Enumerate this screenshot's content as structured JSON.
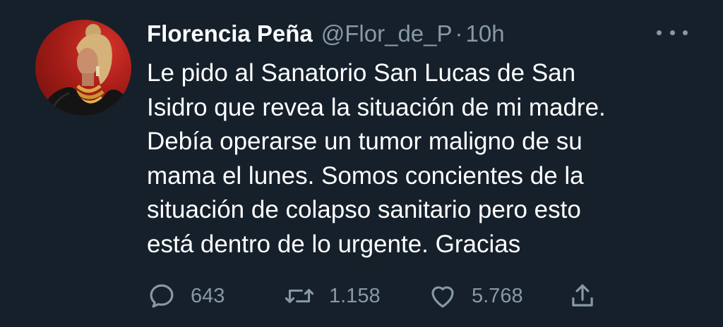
{
  "tweet": {
    "author": {
      "display_name": "Florencia Peña",
      "handle": "@Flor_de_P"
    },
    "separator": "·",
    "time": "10h",
    "text": "Le pido al Sanatorio San Lucas de San\nIsidro que revea la situación de mi madre.\nDebía operarse un tumor maligno de su\nmama el lunes. Somos concientes de la\nsituación de colapso sanitario pero esto\nestá dentro de lo urgente. Gracias",
    "actions": {
      "replies": "643",
      "retweets": "1.158",
      "likes": "5.768"
    }
  },
  "icons": {
    "reply": "reply-icon",
    "retweet": "retweet-icon",
    "like": "heart-icon",
    "share": "share-icon",
    "more": "more-icon"
  },
  "colors": {
    "background": "#15202b",
    "secondary_text": "#8899a6",
    "primary_text": "#ffffff"
  }
}
